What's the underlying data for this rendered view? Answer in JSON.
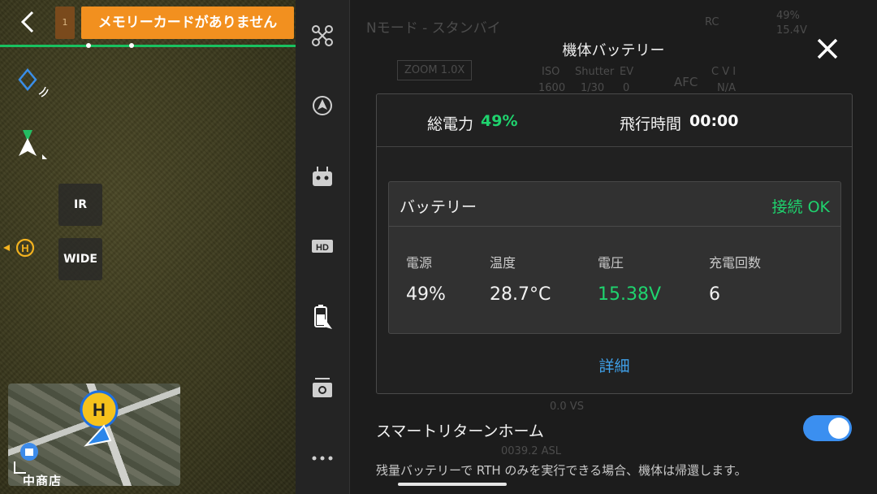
{
  "camera": {
    "storage_slot": "1",
    "sd_warning": "メモリーカードがありません",
    "lens_buttons": [
      "IR",
      "WIDE"
    ],
    "map_label": "中商店"
  },
  "hud_background": {
    "mode": "Nモード - スタンバイ",
    "signal": "RC",
    "battery_pct": "49%",
    "voltage": "15.4V",
    "zoom": "ZOOM 1.0X",
    "iso_label": "ISO",
    "iso_value": "1600",
    "shutter_label": "Shutter",
    "shutter_value": "1/30",
    "ev_label": "EV",
    "ev_value": "0",
    "afc": "AFC",
    "cvi": "C V I",
    "na": "N/A",
    "vs": "0.0 VS",
    "asl": "0039.2 ASL"
  },
  "panel": {
    "title": "機体バッテリー",
    "summary": {
      "total_label": "総電力",
      "total_value": "49%",
      "flight_time_label": "飛行時間",
      "flight_time_value": "00:00"
    },
    "battery": {
      "title": "バッテリー",
      "status": "接続 OK",
      "metrics": [
        {
          "label": "電源",
          "value": "49%"
        },
        {
          "label": "温度",
          "value": "28.7°C"
        },
        {
          "label": "電圧",
          "value": "15.38V"
        },
        {
          "label": "充電回数",
          "value": "6"
        }
      ]
    },
    "details_link": "詳細",
    "smart_rth": {
      "label": "スマートリターンホーム",
      "enabled": true,
      "description": "残量バッテリーで RTH のみを実行できる場合、機体は帰還します。"
    }
  },
  "colors": {
    "accent_green": "#1fd36e",
    "link_blue": "#3fa0e8",
    "toggle_blue": "#3b8ff0",
    "warning_orange": "#f2901f"
  }
}
